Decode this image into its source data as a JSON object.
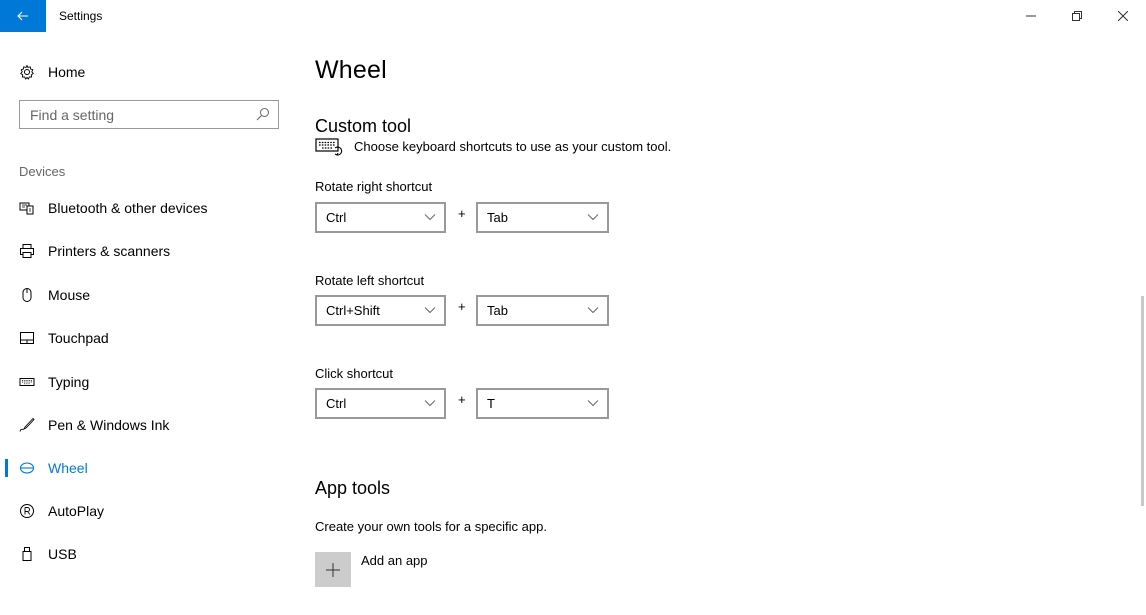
{
  "window": {
    "title": "Settings",
    "back_icon": "back-arrow-icon",
    "accent": "#0078d7"
  },
  "sidebar": {
    "home_label": "Home",
    "search_placeholder": "Find a setting",
    "section_label": "Devices",
    "items": [
      {
        "label": "Bluetooth & other devices",
        "icon": "bluetooth-devices-icon",
        "active": false
      },
      {
        "label": "Printers & scanners",
        "icon": "printer-icon",
        "active": false
      },
      {
        "label": "Mouse",
        "icon": "mouse-icon",
        "active": false
      },
      {
        "label": "Touchpad",
        "icon": "touchpad-icon",
        "active": false
      },
      {
        "label": "Typing",
        "icon": "keyboard-icon",
        "active": false
      },
      {
        "label": "Pen & Windows Ink",
        "icon": "pen-icon",
        "active": false
      },
      {
        "label": "Wheel",
        "icon": "wheel-icon",
        "active": true
      },
      {
        "label": "AutoPlay",
        "icon": "autoplay-icon",
        "active": false
      },
      {
        "label": "USB",
        "icon": "usb-icon",
        "active": false
      }
    ]
  },
  "main": {
    "title": "Wheel",
    "custom_tool": {
      "heading": "Custom tool",
      "description": "Choose keyboard shortcuts to use as your custom tool.",
      "shortcuts": [
        {
          "label": "Rotate right shortcut",
          "modifier": "Ctrl",
          "key": "Tab"
        },
        {
          "label": "Rotate left shortcut",
          "modifier": "Ctrl+Shift",
          "key": "Tab"
        },
        {
          "label": "Click shortcut",
          "modifier": "Ctrl",
          "key": "T"
        }
      ],
      "plus": "+"
    },
    "app_tools": {
      "heading": "App tools",
      "description": "Create your own tools for a specific app.",
      "add_label": "Add an app"
    }
  }
}
